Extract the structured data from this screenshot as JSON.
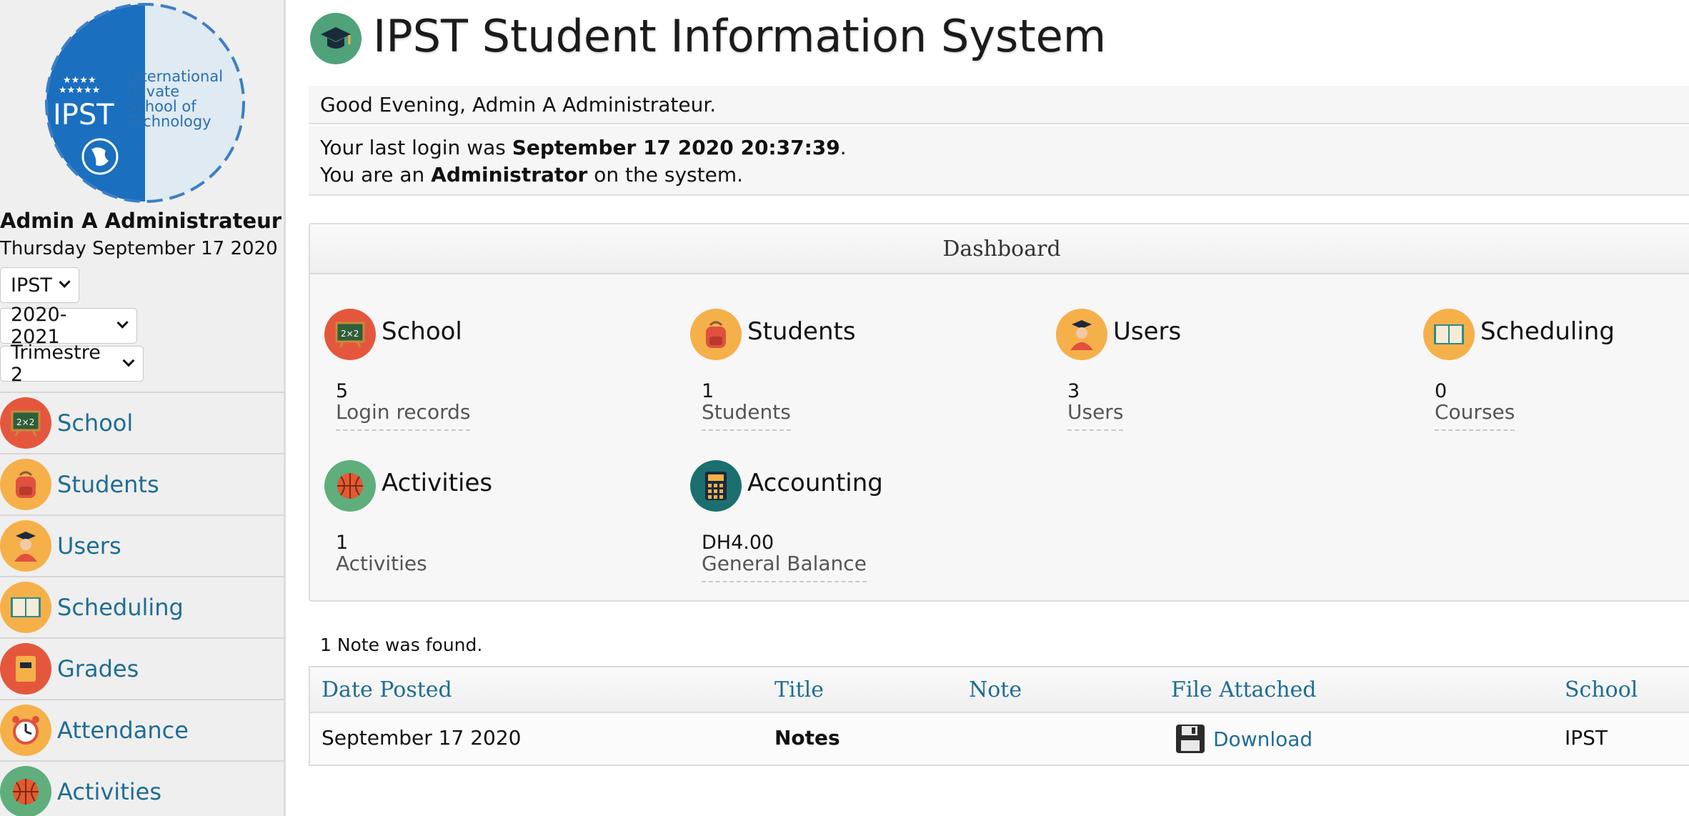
{
  "app": {
    "title": "IPST Student Information System",
    "accent_color": "#1f6d93"
  },
  "logo": {
    "text_abbrev": "IPST",
    "text_full": [
      "International",
      "Private",
      "School of",
      "Technology"
    ]
  },
  "sidebar": {
    "user_name": "Admin A Administrateur",
    "date": "Thursday September 17 2020",
    "school_select": "IPST",
    "year_select": "2020-2021",
    "term_select": "Trimestre 2",
    "items": [
      {
        "label": "School",
        "icon": "chalkboard-icon"
      },
      {
        "label": "Students",
        "icon": "backpack-icon"
      },
      {
        "label": "Users",
        "icon": "graduate-user-icon"
      },
      {
        "label": "Scheduling",
        "icon": "open-book-icon"
      },
      {
        "label": "Grades",
        "icon": "grade-book-icon"
      },
      {
        "label": "Attendance",
        "icon": "alarm-clock-icon"
      },
      {
        "label": "Activities",
        "icon": "basketball-icon"
      }
    ]
  },
  "greeting": {
    "text": "Good Evening, Admin A Administrateur.",
    "login_prefix": "Your last login was ",
    "login_date": "September 17 2020 20:37:39",
    "login_suffix": ".",
    "role_prefix": "You are an ",
    "role": "Administrator",
    "role_suffix": " on the system."
  },
  "dashboard": {
    "title": "Dashboard",
    "tiles": [
      {
        "title": "School",
        "value": "5",
        "label": "Login records",
        "icon": "chalkboard-icon"
      },
      {
        "title": "Students",
        "value": "1",
        "label": "Students",
        "icon": "backpack-icon"
      },
      {
        "title": "Users",
        "value": "3",
        "label": "Users",
        "icon": "graduate-user-icon"
      },
      {
        "title": "Scheduling",
        "value": "0",
        "label": "Courses",
        "icon": "open-book-icon"
      },
      {
        "title": "Activities",
        "value": "1",
        "label": "Activities",
        "icon": "basketball-icon"
      },
      {
        "title": "Accounting",
        "value": "DH4.00",
        "label": "General Balance",
        "icon": "calculator-icon"
      }
    ]
  },
  "notes": {
    "count_text": "1 Note was found.",
    "columns": [
      "Date Posted",
      "Title",
      "Note",
      "File Attached",
      "School"
    ],
    "rows": [
      {
        "date": "September 17 2020",
        "title": "Notes",
        "note": "",
        "file": "Download",
        "school": "IPST"
      }
    ]
  }
}
